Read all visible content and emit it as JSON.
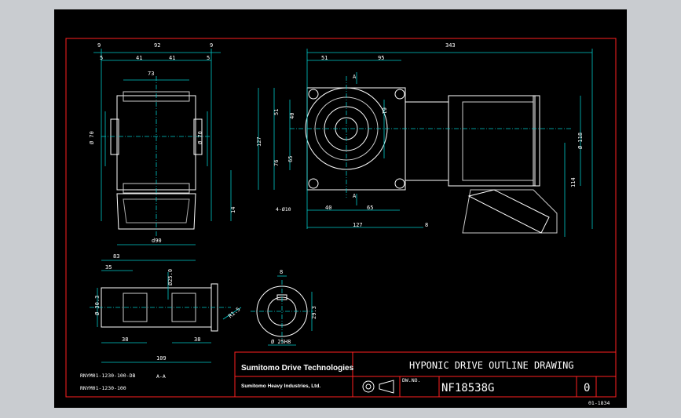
{
  "title_block": {
    "brand": "Sumitomo Drive Technologies",
    "company": "Sumitomo Heavy Industries, Ltd.",
    "drawing_title": "HYPONIC DRIVE OUTLINE DRAWING",
    "small_label": "DW.NO.",
    "model": "NF18538G",
    "revision": "0",
    "sheet_code": "01-1834"
  },
  "notes": {
    "part1": "RNYM01-1230-100-DB",
    "part2": "RNYM01-1230-100",
    "section": "A-A"
  },
  "dims": {
    "top_9": "9",
    "top_92": "92",
    "top_9b": "9",
    "s5a": "5",
    "s41a": "41",
    "s41b": "41",
    "s5b": "5",
    "w73": "73",
    "phi70a": "Ø 70",
    "phi70b": "Ø 70",
    "v14": "14",
    "d90": "d90",
    "h343": "343",
    "h51": "51",
    "h95": "95",
    "v51": "51",
    "v40": "40",
    "v127": "127",
    "v76": "76",
    "v65": "65",
    "v61": "61",
    "holes": "4-Ø10",
    "b40": "40",
    "b65": "65",
    "b127": "127",
    "b8": "8",
    "phi118": "Ø 118",
    "v114": "114",
    "A1": "A",
    "A2": "A",
    "s83": "83",
    "s35": "35",
    "phi25": "Ø25.0",
    "phi30": "Ø 30.3",
    "s38a": "38",
    "s38b": "38",
    "s109": "109",
    "r15": "R1.5",
    "k8": "8",
    "k293": "29.3",
    "k25": "Ø 25H8"
  }
}
